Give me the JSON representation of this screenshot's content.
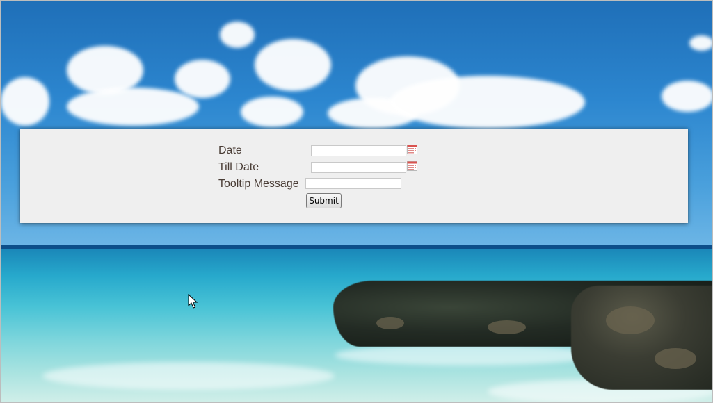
{
  "form": {
    "date_label": "Date",
    "date_value": "",
    "till_date_label": "Till Date",
    "till_date_value": "",
    "tooltip_label": "Tooltip Message",
    "tooltip_value": "",
    "submit_label": "Submit"
  },
  "icons": {
    "date_picker": "calendar-icon",
    "till_date_picker": "calendar-icon",
    "pointer": "mouse-cursor-icon"
  },
  "colors": {
    "panel_background": "#efefef",
    "label_text": "#4a3d36",
    "calendar_accent": "#d9534f"
  }
}
